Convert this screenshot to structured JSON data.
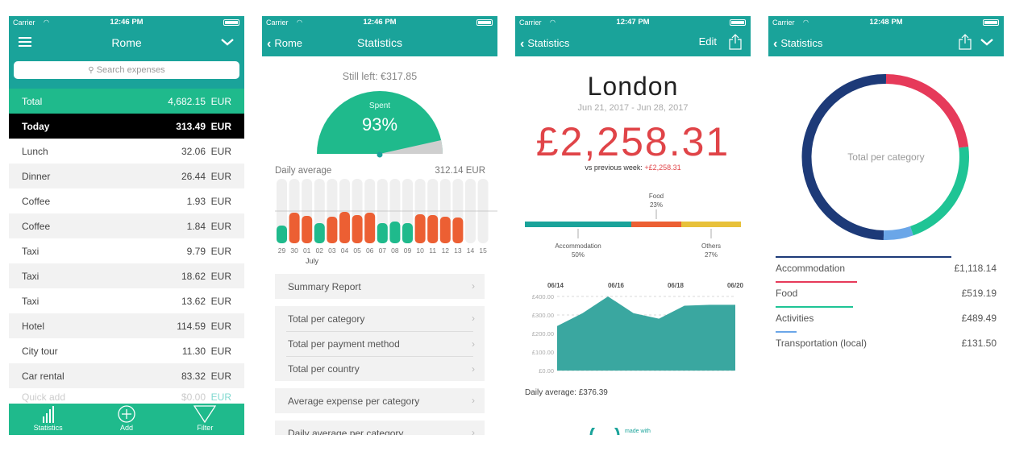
{
  "colors": {
    "teal": "#1aa39a",
    "green": "#1fba8c",
    "orange": "#ec5f33",
    "red": "#e04448",
    "yellow": "#e8c13a",
    "navy": "#1d3a78",
    "blue": "#6aa6e8"
  },
  "status": {
    "carrier": "Carrier",
    "time1": "12:46 PM",
    "time2": "12:46 PM",
    "time3": "12:47 PM",
    "time4": "12:48 PM"
  },
  "screen1": {
    "title": "Rome",
    "search_placeholder": "Search expenses",
    "total": {
      "label": "Total",
      "value": "4,682.15",
      "currency": "EUR"
    },
    "today": {
      "label": "Today",
      "value": "313.49",
      "currency": "EUR"
    },
    "expenses": [
      {
        "label": "Lunch",
        "value": "32.06",
        "currency": "EUR"
      },
      {
        "label": "Dinner",
        "value": "26.44",
        "currency": "EUR"
      },
      {
        "label": "Coffee",
        "value": "1.93",
        "currency": "EUR"
      },
      {
        "label": "Coffee",
        "value": "1.84",
        "currency": "EUR"
      },
      {
        "label": "Taxi",
        "value": "9.79",
        "currency": "EUR"
      },
      {
        "label": "Taxi",
        "value": "18.62",
        "currency": "EUR"
      },
      {
        "label": "Taxi",
        "value": "13.62",
        "currency": "EUR"
      },
      {
        "label": "Hotel",
        "value": "114.59",
        "currency": "EUR"
      },
      {
        "label": "City tour",
        "value": "11.30",
        "currency": "EUR"
      },
      {
        "label": "Car rental",
        "value": "83.32",
        "currency": "EUR"
      }
    ],
    "quick_add": {
      "label": "Quick add",
      "value": "$0.00",
      "currency": "EUR"
    },
    "tabs": {
      "statistics": "Statistics",
      "add": "Add",
      "filter": "Filter"
    }
  },
  "screen2": {
    "back": "Rome",
    "title": "Statistics",
    "still_left": "Still left: €317.85",
    "gauge": {
      "label": "Spent",
      "percent": "93%",
      "fraction": 0.93
    },
    "daily_average_label": "Daily average",
    "daily_average_value": "312.14  EUR",
    "days": [
      "29",
      "30",
      "01",
      "02",
      "03",
      "04",
      "05",
      "06",
      "07",
      "08",
      "09",
      "10",
      "11",
      "12",
      "13",
      "14",
      "15"
    ],
    "month": "July",
    "menu": {
      "summary": "Summary Report",
      "per_category": "Total per category",
      "per_payment": "Total per payment method",
      "per_country": "Total per country",
      "avg_category": "Average expense per category",
      "daily_avg_category": "Daily average per category"
    }
  },
  "screen3": {
    "back": "Statistics",
    "edit": "Edit",
    "city": "London",
    "date_range": "Jun 21, 2017 - Jun 28, 2017",
    "amount": "£2,258.31",
    "vs_prev_label": "vs previous week:",
    "vs_prev_value": "+£2,258.31",
    "breakdown": {
      "food": {
        "label": "Food",
        "pct": "23%"
      },
      "accommodation": {
        "label": "Accommodation",
        "pct": "50%"
      },
      "others": {
        "label": "Others",
        "pct": "27%"
      }
    },
    "area_chart": {
      "x_labels": [
        "06/14",
        "06/16",
        "06/18",
        "06/20"
      ],
      "y_labels": [
        "£400.00",
        "£300.00",
        "£200.00",
        "£100.00",
        "£0.00"
      ]
    },
    "daily_average": "Daily average: £376.39",
    "made_with": "made with"
  },
  "screen4": {
    "back": "Statistics",
    "donut_label": "Total per category",
    "categories": [
      {
        "name": "Accommodation",
        "amount": "£1,118.14",
        "color": "#1d3a78"
      },
      {
        "name": "Food",
        "amount": "£519.19",
        "color": "#e63a5a"
      },
      {
        "name": "Activities",
        "amount": "£489.49",
        "color": "#1fc495"
      },
      {
        "name": "Transportation (local)",
        "amount": "£131.50",
        "color": "#6aa6e8"
      }
    ]
  },
  "chart_data": [
    {
      "type": "area",
      "x": [
        "06/14",
        "06/15",
        "06/16",
        "06/17",
        "06/18",
        "06/19",
        "06/20",
        "06/21"
      ],
      "values": [
        240,
        310,
        400,
        310,
        280,
        350,
        355,
        355
      ],
      "ylim": [
        0,
        400
      ],
      "y_ticks": [
        "£0.00",
        "£100.00",
        "£200.00",
        "£300.00",
        "£400.00"
      ],
      "x_ticks": [
        "06/14",
        "06/16",
        "06/18",
        "06/20"
      ],
      "grid": true
    },
    {
      "type": "bar",
      "categories": [
        "29",
        "30",
        "01",
        "02",
        "03",
        "04",
        "05",
        "06",
        "07",
        "08",
        "09",
        "10",
        "11",
        "12",
        "13",
        "14",
        "15"
      ],
      "values": [
        220,
        380,
        340,
        250,
        330,
        390,
        350,
        380,
        250,
        270,
        250,
        360,
        350,
        330,
        320,
        0,
        0
      ],
      "ylim": [
        0,
        800
      ],
      "series_colors": [
        "green",
        "orange",
        "orange",
        "green",
        "orange",
        "orange",
        "orange",
        "orange",
        "green",
        "green",
        "green",
        "orange",
        "orange",
        "orange",
        "orange",
        "none",
        "none"
      ]
    },
    {
      "type": "pie",
      "categories": [
        "Accommodation",
        "Food",
        "Activities",
        "Transportation (local)"
      ],
      "values": [
        1118.14,
        519.19,
        489.49,
        131.5
      ],
      "title": "Total per category"
    }
  ]
}
